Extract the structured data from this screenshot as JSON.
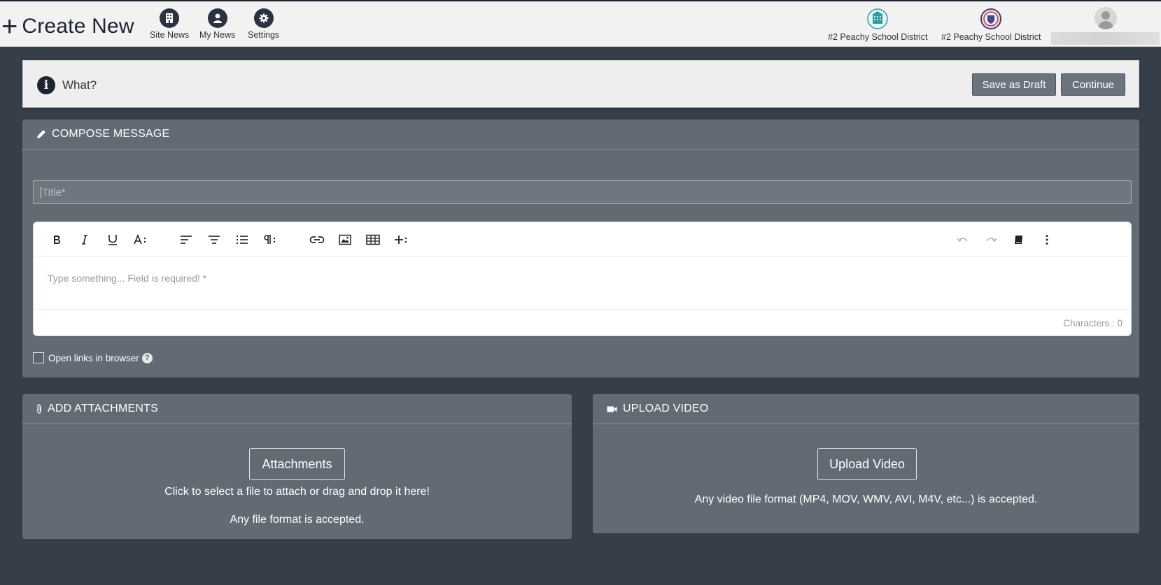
{
  "header": {
    "create_new": "Create New",
    "nav": [
      {
        "label": "Site News",
        "icon": "building-icon"
      },
      {
        "label": "My News",
        "icon": "person-icon"
      },
      {
        "label": "Settings",
        "icon": "gear-icon"
      }
    ],
    "districts": [
      {
        "label": "#2 Peachy School District",
        "icon": "district-building-logo"
      },
      {
        "label": "#2 Peachy School District",
        "icon": "district-shield-logo"
      }
    ],
    "user_avatar": "avatar-icon"
  },
  "what_bar": {
    "label": "What?",
    "save_draft": "Save as Draft",
    "continue": "Continue"
  },
  "compose": {
    "header": "COMPOSE MESSAGE",
    "title_placeholder": "Title*",
    "editor_placeholder": "Type something... Field is required! *",
    "char_count": "Characters : 0",
    "open_links_label": "Open links in browser",
    "help": "?"
  },
  "attachments": {
    "header": "ADD ATTACHMENTS",
    "button": "Attachments",
    "hint1": "Click to select a file to attach or drag and drop it here!",
    "hint2": "Any file format is accepted."
  },
  "video": {
    "header": "UPLOAD VIDEO",
    "button": "Upload Video",
    "hint": "Any video file format (MP4, MOV, WMV, AVI, M4V, etc...) is accepted."
  },
  "colors": {
    "page_bg": "#363f49",
    "topbar_bg": "#f2f2f2",
    "panel_bg": "#626a73",
    "button_dark": "#6b737c"
  }
}
